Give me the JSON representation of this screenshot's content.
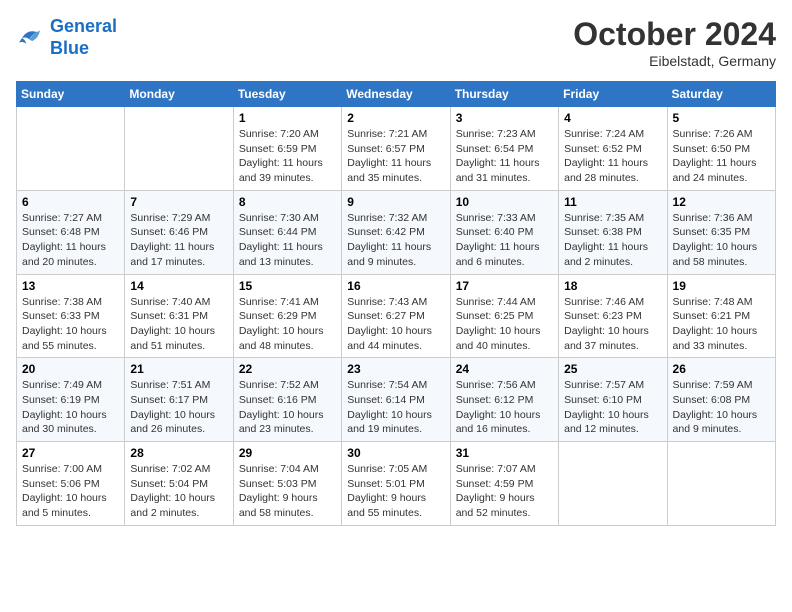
{
  "header": {
    "logo_line1": "General",
    "logo_line2": "Blue",
    "month": "October 2024",
    "location": "Eibelstadt, Germany"
  },
  "weekdays": [
    "Sunday",
    "Monday",
    "Tuesday",
    "Wednesday",
    "Thursday",
    "Friday",
    "Saturday"
  ],
  "weeks": [
    [
      {
        "day": "",
        "info": ""
      },
      {
        "day": "",
        "info": ""
      },
      {
        "day": "1",
        "info": "Sunrise: 7:20 AM\nSunset: 6:59 PM\nDaylight: 11 hours and 39 minutes."
      },
      {
        "day": "2",
        "info": "Sunrise: 7:21 AM\nSunset: 6:57 PM\nDaylight: 11 hours and 35 minutes."
      },
      {
        "day": "3",
        "info": "Sunrise: 7:23 AM\nSunset: 6:54 PM\nDaylight: 11 hours and 31 minutes."
      },
      {
        "day": "4",
        "info": "Sunrise: 7:24 AM\nSunset: 6:52 PM\nDaylight: 11 hours and 28 minutes."
      },
      {
        "day": "5",
        "info": "Sunrise: 7:26 AM\nSunset: 6:50 PM\nDaylight: 11 hours and 24 minutes."
      }
    ],
    [
      {
        "day": "6",
        "info": "Sunrise: 7:27 AM\nSunset: 6:48 PM\nDaylight: 11 hours and 20 minutes."
      },
      {
        "day": "7",
        "info": "Sunrise: 7:29 AM\nSunset: 6:46 PM\nDaylight: 11 hours and 17 minutes."
      },
      {
        "day": "8",
        "info": "Sunrise: 7:30 AM\nSunset: 6:44 PM\nDaylight: 11 hours and 13 minutes."
      },
      {
        "day": "9",
        "info": "Sunrise: 7:32 AM\nSunset: 6:42 PM\nDaylight: 11 hours and 9 minutes."
      },
      {
        "day": "10",
        "info": "Sunrise: 7:33 AM\nSunset: 6:40 PM\nDaylight: 11 hours and 6 minutes."
      },
      {
        "day": "11",
        "info": "Sunrise: 7:35 AM\nSunset: 6:38 PM\nDaylight: 11 hours and 2 minutes."
      },
      {
        "day": "12",
        "info": "Sunrise: 7:36 AM\nSunset: 6:35 PM\nDaylight: 10 hours and 58 minutes."
      }
    ],
    [
      {
        "day": "13",
        "info": "Sunrise: 7:38 AM\nSunset: 6:33 PM\nDaylight: 10 hours and 55 minutes."
      },
      {
        "day": "14",
        "info": "Sunrise: 7:40 AM\nSunset: 6:31 PM\nDaylight: 10 hours and 51 minutes."
      },
      {
        "day": "15",
        "info": "Sunrise: 7:41 AM\nSunset: 6:29 PM\nDaylight: 10 hours and 48 minutes."
      },
      {
        "day": "16",
        "info": "Sunrise: 7:43 AM\nSunset: 6:27 PM\nDaylight: 10 hours and 44 minutes."
      },
      {
        "day": "17",
        "info": "Sunrise: 7:44 AM\nSunset: 6:25 PM\nDaylight: 10 hours and 40 minutes."
      },
      {
        "day": "18",
        "info": "Sunrise: 7:46 AM\nSunset: 6:23 PM\nDaylight: 10 hours and 37 minutes."
      },
      {
        "day": "19",
        "info": "Sunrise: 7:48 AM\nSunset: 6:21 PM\nDaylight: 10 hours and 33 minutes."
      }
    ],
    [
      {
        "day": "20",
        "info": "Sunrise: 7:49 AM\nSunset: 6:19 PM\nDaylight: 10 hours and 30 minutes."
      },
      {
        "day": "21",
        "info": "Sunrise: 7:51 AM\nSunset: 6:17 PM\nDaylight: 10 hours and 26 minutes."
      },
      {
        "day": "22",
        "info": "Sunrise: 7:52 AM\nSunset: 6:16 PM\nDaylight: 10 hours and 23 minutes."
      },
      {
        "day": "23",
        "info": "Sunrise: 7:54 AM\nSunset: 6:14 PM\nDaylight: 10 hours and 19 minutes."
      },
      {
        "day": "24",
        "info": "Sunrise: 7:56 AM\nSunset: 6:12 PM\nDaylight: 10 hours and 16 minutes."
      },
      {
        "day": "25",
        "info": "Sunrise: 7:57 AM\nSunset: 6:10 PM\nDaylight: 10 hours and 12 minutes."
      },
      {
        "day": "26",
        "info": "Sunrise: 7:59 AM\nSunset: 6:08 PM\nDaylight: 10 hours and 9 minutes."
      }
    ],
    [
      {
        "day": "27",
        "info": "Sunrise: 7:00 AM\nSunset: 5:06 PM\nDaylight: 10 hours and 5 minutes."
      },
      {
        "day": "28",
        "info": "Sunrise: 7:02 AM\nSunset: 5:04 PM\nDaylight: 10 hours and 2 minutes."
      },
      {
        "day": "29",
        "info": "Sunrise: 7:04 AM\nSunset: 5:03 PM\nDaylight: 9 hours and 58 minutes."
      },
      {
        "day": "30",
        "info": "Sunrise: 7:05 AM\nSunset: 5:01 PM\nDaylight: 9 hours and 55 minutes."
      },
      {
        "day": "31",
        "info": "Sunrise: 7:07 AM\nSunset: 4:59 PM\nDaylight: 9 hours and 52 minutes."
      },
      {
        "day": "",
        "info": ""
      },
      {
        "day": "",
        "info": ""
      }
    ]
  ]
}
